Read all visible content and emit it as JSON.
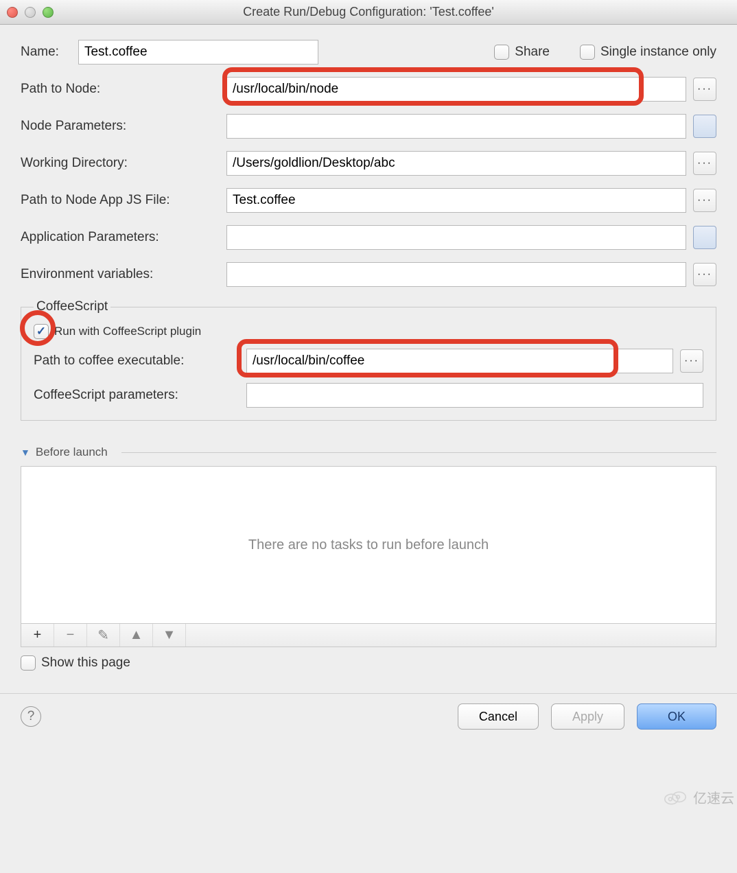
{
  "window": {
    "title": "Create Run/Debug Configuration: 'Test.coffee'"
  },
  "form": {
    "name_label": "Name:",
    "name_value": "Test.coffee",
    "share_label": "Share",
    "single_instance_label": "Single instance only",
    "fields": {
      "path_to_node": {
        "label": "Path to Node:",
        "value": "/usr/local/bin/node"
      },
      "node_params": {
        "label": "Node Parameters:",
        "value": ""
      },
      "working_dir": {
        "label": "Working Directory:",
        "value": "/Users/goldlion/Desktop/abc"
      },
      "app_js": {
        "label": "Path to Node App JS File:",
        "value": "Test.coffee"
      },
      "app_params": {
        "label": "Application Parameters:",
        "value": ""
      },
      "env_vars": {
        "label": "Environment variables:",
        "value": ""
      }
    }
  },
  "coffee": {
    "legend": "CoffeeScript",
    "run_with_plugin_label": "Run with CoffeeScript plugin",
    "path_label": "Path to coffee executable:",
    "path_value": "/usr/local/bin/coffee",
    "params_label": "CoffeeScript parameters:",
    "params_value": ""
  },
  "before_launch": {
    "title": "Before launch",
    "empty_text": "There are no tasks to run before launch",
    "show_page_label": "Show this page"
  },
  "buttons": {
    "cancel": "Cancel",
    "apply": "Apply",
    "ok": "OK"
  },
  "highlight_color": "#e03c2a",
  "watermark": "亿速云"
}
